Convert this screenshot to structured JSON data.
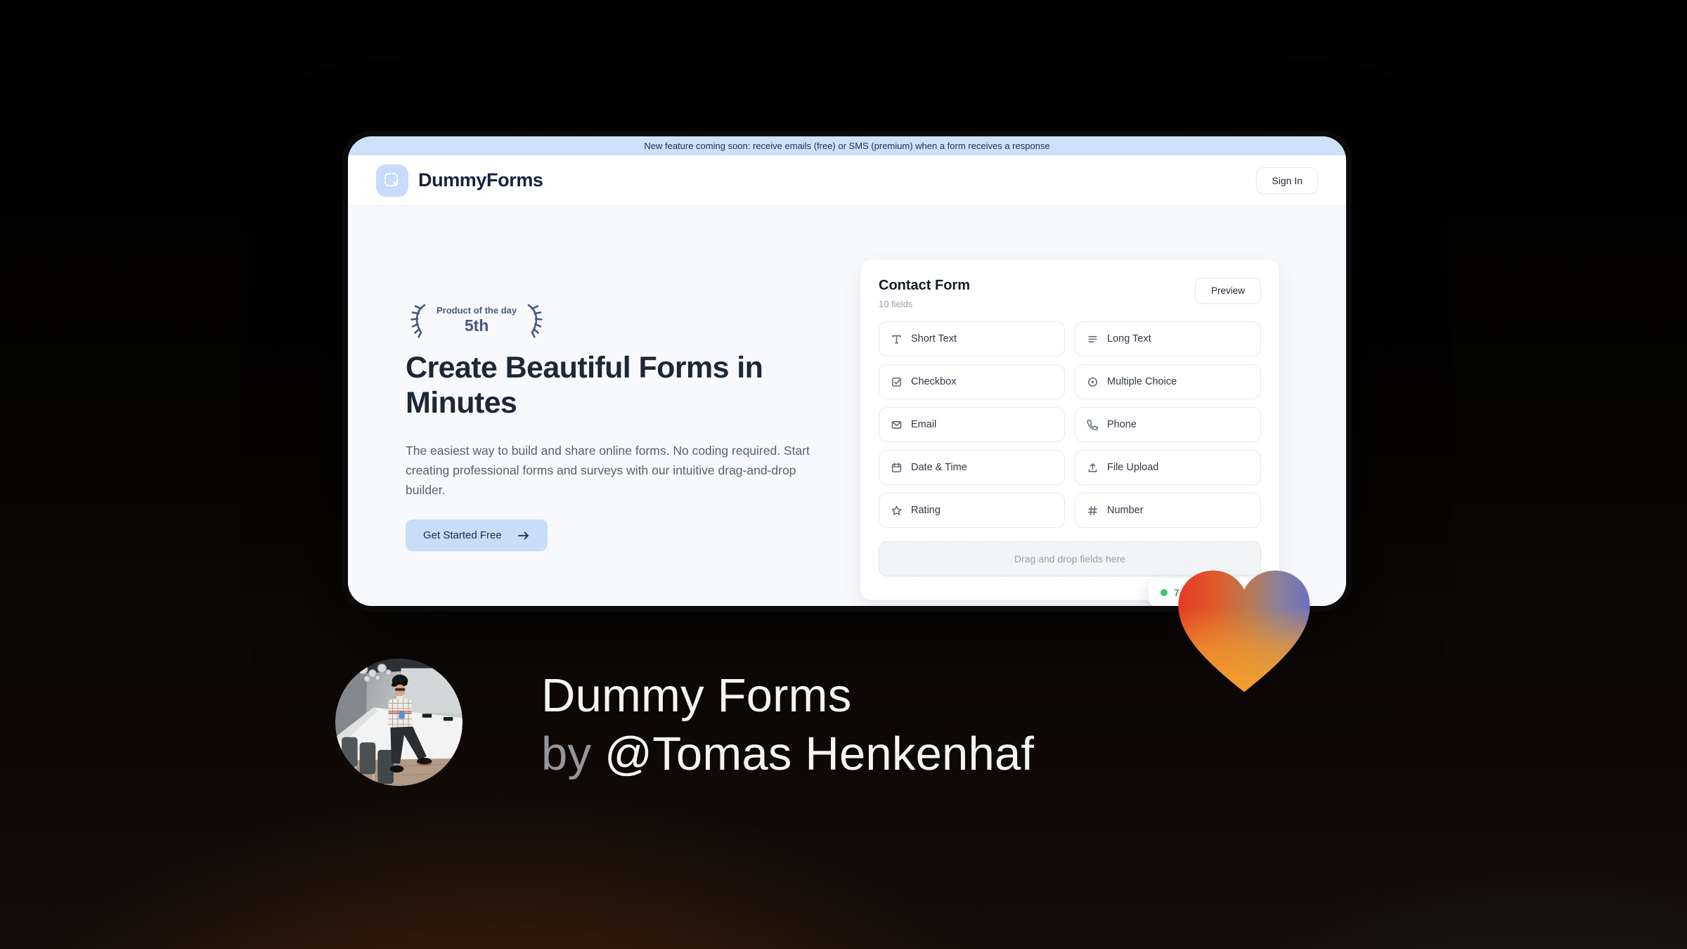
{
  "banner": {
    "text": "New feature coming soon: receive emails (free) or SMS (premium) when a form receives a response"
  },
  "header": {
    "brand": "DummyForms",
    "sign_in_label": "Sign In"
  },
  "hero": {
    "award": {
      "title": "Product of the day",
      "rank": "5th"
    },
    "title": "Create Beautiful Forms in Minutes",
    "description": "The easiest way to build and share online forms. No coding required. Start creating professional forms and surveys with our intuitive drag-and-drop builder.",
    "cta_label": "Get Started Free"
  },
  "form_card": {
    "title": "Contact Form",
    "subtitle": "10 fields",
    "preview_label": "Preview",
    "fields": [
      {
        "label": "Short Text",
        "icon": "short-text-icon"
      },
      {
        "label": "Long Text",
        "icon": "long-text-icon"
      },
      {
        "label": "Checkbox",
        "icon": "checkbox-icon"
      },
      {
        "label": "Multiple Choice",
        "icon": "multiple-choice-icon"
      },
      {
        "label": "Email",
        "icon": "email-icon"
      },
      {
        "label": "Phone",
        "icon": "phone-icon"
      },
      {
        "label": "Date & Time",
        "icon": "calendar-icon"
      },
      {
        "label": "File Upload",
        "icon": "upload-icon"
      },
      {
        "label": "Rating",
        "icon": "star-icon"
      },
      {
        "label": "Number",
        "icon": "hash-icon"
      }
    ],
    "dropzone_text": "Drag and drop fields here",
    "status_badge": {
      "text": "7",
      "dot_color": "#3ec66a"
    }
  },
  "footer": {
    "product_name": "Dummy Forms",
    "byline_prefix": "by",
    "byline_author": "@Tomas Henkenhaf"
  },
  "colors": {
    "banner_blue": "#cfe0fa",
    "accent_light_blue": "#c9dcf8",
    "logo_tile_blue": "#c7dbfa",
    "page_bg": "#f7f9fc",
    "headline_navy": "#1c2738",
    "laurel_navy": "#49587e",
    "status_green": "#3ec66a",
    "heart_red": "#e43a24",
    "heart_orange": "#f3a02b",
    "heart_blue": "#6f72c0"
  }
}
